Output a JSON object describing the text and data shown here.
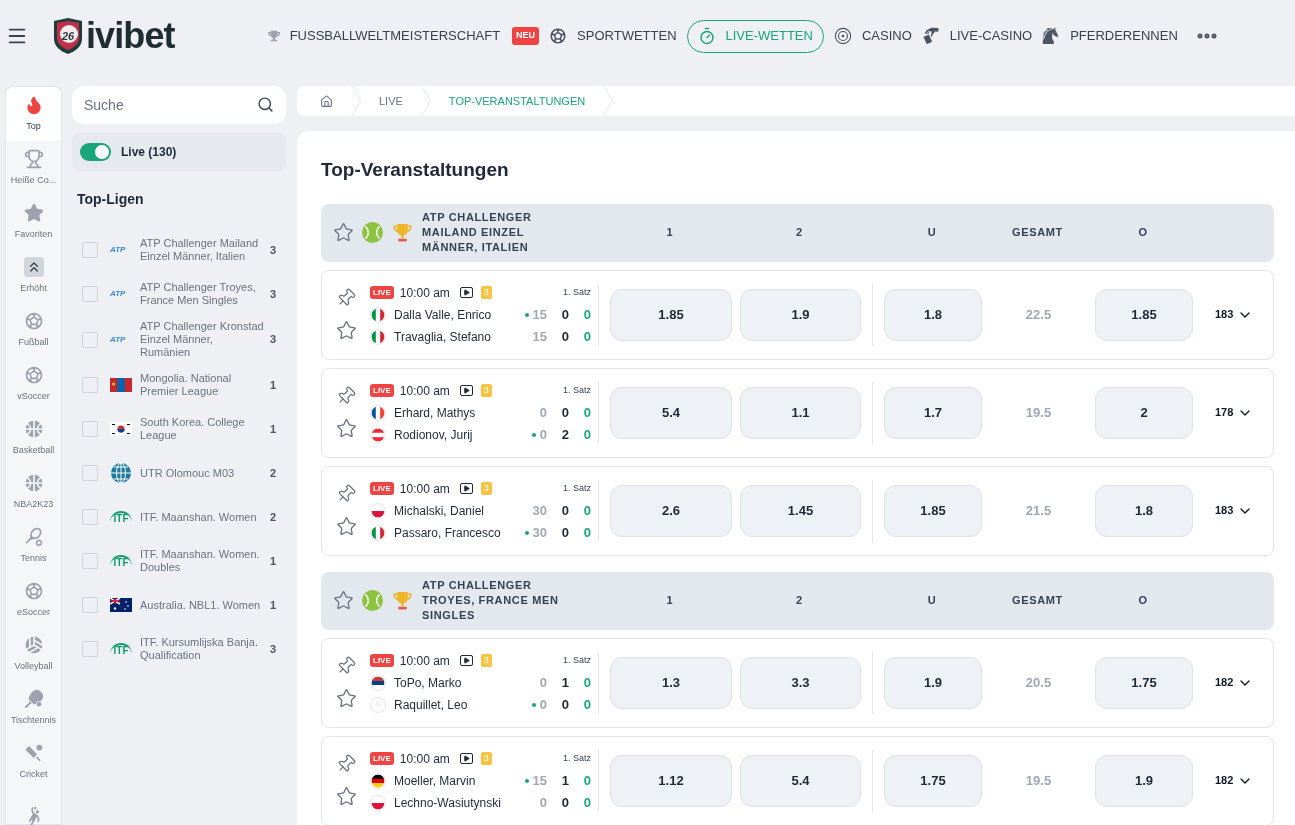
{
  "header": {
    "logo_badge": "26",
    "brand": "ivibet",
    "nav": [
      {
        "label": "FUSSBALLWELTMEISTERSCHAFT",
        "badge": "NEU",
        "selected": false
      },
      {
        "label": "SPORTWETTEN",
        "selected": false
      },
      {
        "label": "LIVE-WETTEN",
        "selected": true
      },
      {
        "label": "CASINO",
        "selected": false
      },
      {
        "label": "LIVE-CASINO",
        "selected": false
      },
      {
        "label": "PFERDERENNEN",
        "selected": false
      }
    ]
  },
  "sports": [
    {
      "label": "Top",
      "selected": true
    },
    {
      "label": "Heiße Co...",
      "selected": false
    },
    {
      "label": "Favoriten",
      "selected": false
    },
    {
      "label": "Erhöht",
      "selected": false
    },
    {
      "label": "Fußball",
      "selected": false
    },
    {
      "label": "vSoccer",
      "selected": false
    },
    {
      "label": "Basketball",
      "selected": false
    },
    {
      "label": "NBA2K23",
      "selected": false
    },
    {
      "label": "Tennis",
      "selected": false
    },
    {
      "label": "eSoccer",
      "selected": false
    },
    {
      "label": "Volleyball",
      "selected": false
    },
    {
      "label": "Tischtennis",
      "selected": false
    },
    {
      "label": "Cricket",
      "selected": false
    },
    {
      "selected": false
    }
  ],
  "search": {
    "placeholder": "Suche"
  },
  "live_filter": {
    "label": "Live (130)",
    "on": true
  },
  "top_leagues": {
    "title": "Top-Ligen",
    "items": [
      {
        "kind": "atp",
        "logo": "ATP",
        "name": "ATP Challenger Mailand Einzel Männer, Italien",
        "count": "3",
        "checked": false
      },
      {
        "kind": "atp",
        "logo": "ATP",
        "name": "ATP Challenger Troyes, France Men Singles",
        "count": "3",
        "checked": false
      },
      {
        "kind": "atp",
        "logo": "ATP",
        "name": "ATP Challenger Kronstad Einzel Männer, Rumänien",
        "count": "3",
        "checked": false
      },
      {
        "kind": "mn",
        "name": "Mongolia. National Premier League",
        "count": "1",
        "checked": false
      },
      {
        "kind": "kr",
        "name": "South Korea. College League",
        "count": "1",
        "checked": false
      },
      {
        "kind": "globe",
        "name": "UTR Olomouc M03",
        "count": "2",
        "checked": false
      },
      {
        "kind": "itf",
        "logo": "ITF",
        "name": "ITF. Maanshan. Women",
        "count": "2",
        "checked": false
      },
      {
        "kind": "itf",
        "logo": "ITF",
        "name": "ITF. Maanshan. Women. Doubles",
        "count": "1",
        "checked": false
      },
      {
        "kind": "au",
        "name": "Australia. NBL1. Women",
        "count": "1",
        "checked": false
      },
      {
        "kind": "itf",
        "logo": "ITF",
        "name": "ITF. Kursumlijska Banja. Qualification",
        "count": "3",
        "checked": false
      }
    ]
  },
  "breadcrumb": [
    {
      "label": "LIVE",
      "selected": false
    },
    {
      "label": "TOP-VERANSTALTUNGEN",
      "selected": true
    }
  ],
  "page_title": "Top-Veranstaltungen",
  "groups": [
    {
      "title": "ATP CHALLENGER MAILAND EINZEL MÄNNER, ITALIEN",
      "columns": [
        "1",
        "2",
        "U",
        "GESAMT",
        "O"
      ],
      "events": [
        {
          "live": "LIVE",
          "time": "10:00 am",
          "badge": "3",
          "period": "1. Satz",
          "players": [
            {
              "name": "Dalla Valle, Enrico",
              "kind": "it",
              "serving": true,
              "points": "15",
              "sets": "0",
              "games": "0"
            },
            {
              "name": "Travaglia, Stefano",
              "kind": "it",
              "serving": false,
              "points": "15",
              "sets": "0",
              "games": "0"
            }
          ],
          "odds": [
            "1.85",
            "1.9",
            "1.8",
            "1.85"
          ],
          "total": "22.5",
          "markets": "183"
        },
        {
          "live": "LIVE",
          "time": "10:00 am",
          "badge": "3",
          "period": "1. Satz",
          "players": [
            {
              "name": "Erhard, Mathys",
              "kind": "fr",
              "serving": false,
              "points": "0",
              "sets": "0",
              "games": "0"
            },
            {
              "name": "Rodionov, Jurij",
              "kind": "at",
              "serving": true,
              "points": "0",
              "sets": "2",
              "games": "0"
            }
          ],
          "odds": [
            "5.4",
            "1.1",
            "1.7",
            "2"
          ],
          "total": "19.5",
          "markets": "178"
        },
        {
          "live": "LIVE",
          "time": "10:00 am",
          "badge": "3",
          "period": "1. Satz",
          "players": [
            {
              "name": "Michalski, Daniel",
              "kind": "pl",
              "serving": false,
              "points": "30",
              "sets": "0",
              "games": "0"
            },
            {
              "name": "Passaro, Francesco",
              "kind": "it",
              "serving": true,
              "points": "30",
              "sets": "0",
              "games": "0"
            }
          ],
          "odds": [
            "2.6",
            "1.45",
            "1.85",
            "1.8"
          ],
          "total": "21.5",
          "markets": "183"
        }
      ]
    },
    {
      "title": "ATP CHALLENGER TROYES, FRANCE MEN SINGLES",
      "columns": [
        "1",
        "2",
        "U",
        "GESAMT",
        "O"
      ],
      "events": [
        {
          "live": "LIVE",
          "time": "10:00 am",
          "badge": "3",
          "period": "1. Satz",
          "players": [
            {
              "name": "ToPo, Marko",
              "kind": "rs",
              "serving": false,
              "points": "0",
              "sets": "1",
              "games": "0"
            },
            {
              "name": "Raquillet, Leo",
              "kind": "none",
              "serving": true,
              "points": "0",
              "sets": "0",
              "games": "0"
            }
          ],
          "odds": [
            "1.3",
            "3.3",
            "1.9",
            "1.75"
          ],
          "total": "20.5",
          "markets": "182"
        },
        {
          "live": "LIVE",
          "time": "10:00 am",
          "badge": "3",
          "period": "1. Satz",
          "players": [
            {
              "name": "Moeller, Marvin",
              "kind": "de",
              "serving": true,
              "points": "15",
              "sets": "1",
              "games": "0"
            },
            {
              "name": "Lechno-Wasiutynski",
              "kind": "pl",
              "serving": false,
              "points": "0",
              "sets": "0",
              "games": "0"
            }
          ],
          "odds": [
            "1.12",
            "5.4",
            "1.75",
            "1.9"
          ],
          "total": "19.5",
          "markets": "182"
        }
      ]
    }
  ]
}
